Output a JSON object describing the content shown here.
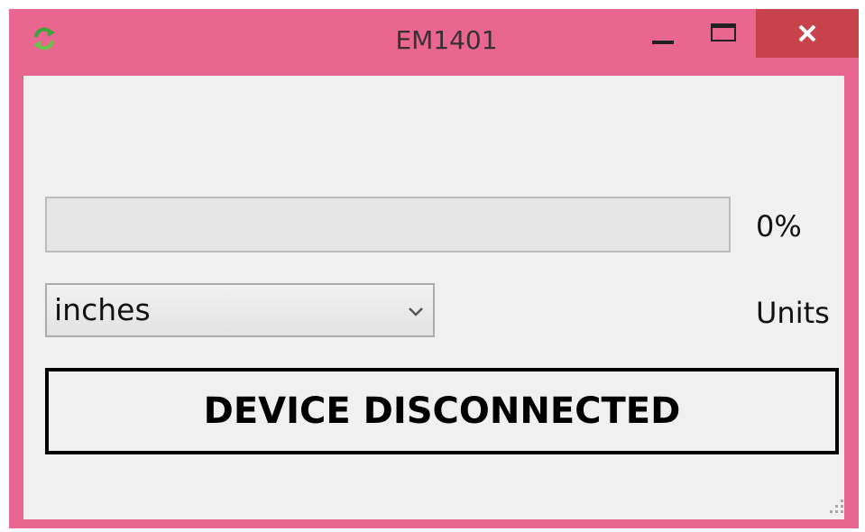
{
  "window": {
    "title": "EM1401",
    "frame_color": "#e8668f",
    "close_color": "#c8424b",
    "app_icon": "refresh-arrows-icon"
  },
  "progress": {
    "value": 0,
    "label": "0%",
    "fill_color": "#06b025"
  },
  "units": {
    "selected": "inches",
    "label": "Units"
  },
  "status": {
    "text": "DEVICE DISCONNECTED"
  }
}
